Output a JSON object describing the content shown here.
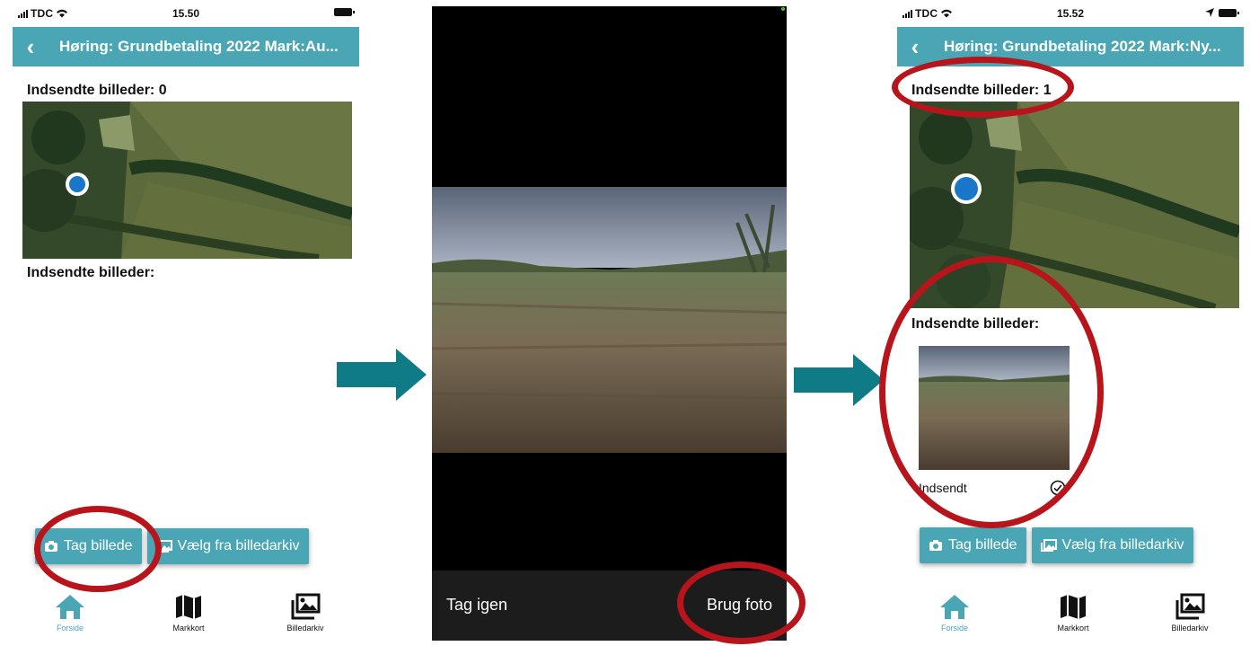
{
  "left_screen": {
    "status": {
      "carrier": "TDC",
      "time": "15.50"
    },
    "title": "Høring: Grundbetaling 2022 Mark:Au...",
    "sent_count_label": "Indsendte billeder: 0",
    "sent_images_label": "Indsendte billeder:",
    "take_photo_label": "Tag billede",
    "choose_archive_label": "Vælg fra billedarkiv",
    "tabs": [
      {
        "label": "Forside",
        "icon": "home-icon",
        "active": true
      },
      {
        "label": "Markkort",
        "icon": "map-icon",
        "active": false
      },
      {
        "label": "Billedarkiv",
        "icon": "gallery-icon",
        "active": false
      }
    ]
  },
  "camera_screen": {
    "retake_label": "Tag igen",
    "use_photo_label": "Brug foto"
  },
  "right_screen": {
    "status": {
      "carrier": "TDC",
      "time": "15.52"
    },
    "title": "Høring: Grundbetaling 2022 Mark:Ny...",
    "sent_count_label": "Indsendte billeder: 1",
    "sent_images_label": "Indsendte billeder:",
    "thumbnail_status": "Indsendt",
    "take_photo_label": "Tag billede",
    "choose_archive_label": "Vælg fra billedarkiv",
    "tabs": [
      {
        "label": "Forside",
        "icon": "home-icon",
        "active": true
      },
      {
        "label": "Markkort",
        "icon": "map-icon",
        "active": false
      },
      {
        "label": "Billedarkiv",
        "icon": "gallery-icon",
        "active": false
      }
    ]
  },
  "colors": {
    "accent": "#4aa6b5",
    "active_tab": "#4aa6b5",
    "annotation_ring": "#b8141b",
    "arrow": "#0f7b86",
    "location_dot": "#1a76c9"
  }
}
